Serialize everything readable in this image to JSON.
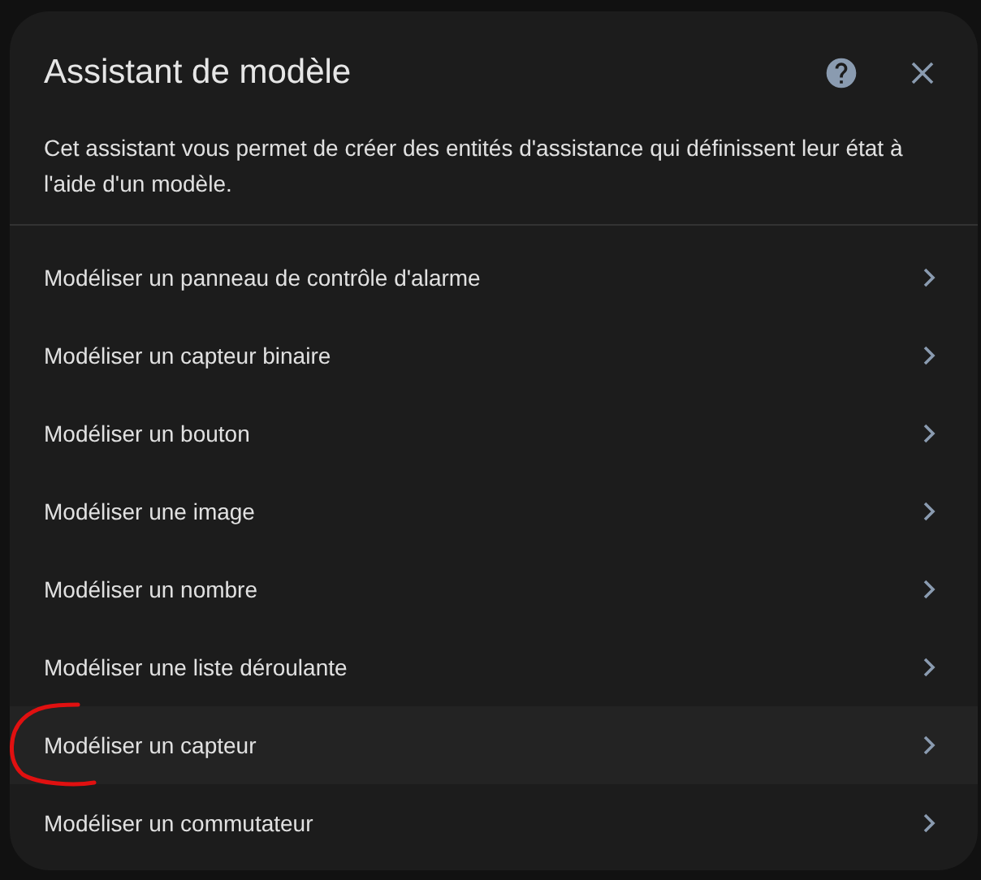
{
  "dialog": {
    "title": "Assistant de modèle",
    "description": "Cet assistant vous permet de créer des entités d'assistance qui définissent leur état à l'aide d'un modèle."
  },
  "items": [
    {
      "label": "Modéliser un panneau de contrôle d'alarme",
      "selected": false
    },
    {
      "label": "Modéliser un capteur binaire",
      "selected": false
    },
    {
      "label": "Modéliser un bouton",
      "selected": false
    },
    {
      "label": "Modéliser une image",
      "selected": false
    },
    {
      "label": "Modéliser un nombre",
      "selected": false
    },
    {
      "label": "Modéliser une liste déroulante",
      "selected": false
    },
    {
      "label": "Modéliser un capteur",
      "selected": true
    },
    {
      "label": "Modéliser un commutateur",
      "selected": false
    }
  ]
}
